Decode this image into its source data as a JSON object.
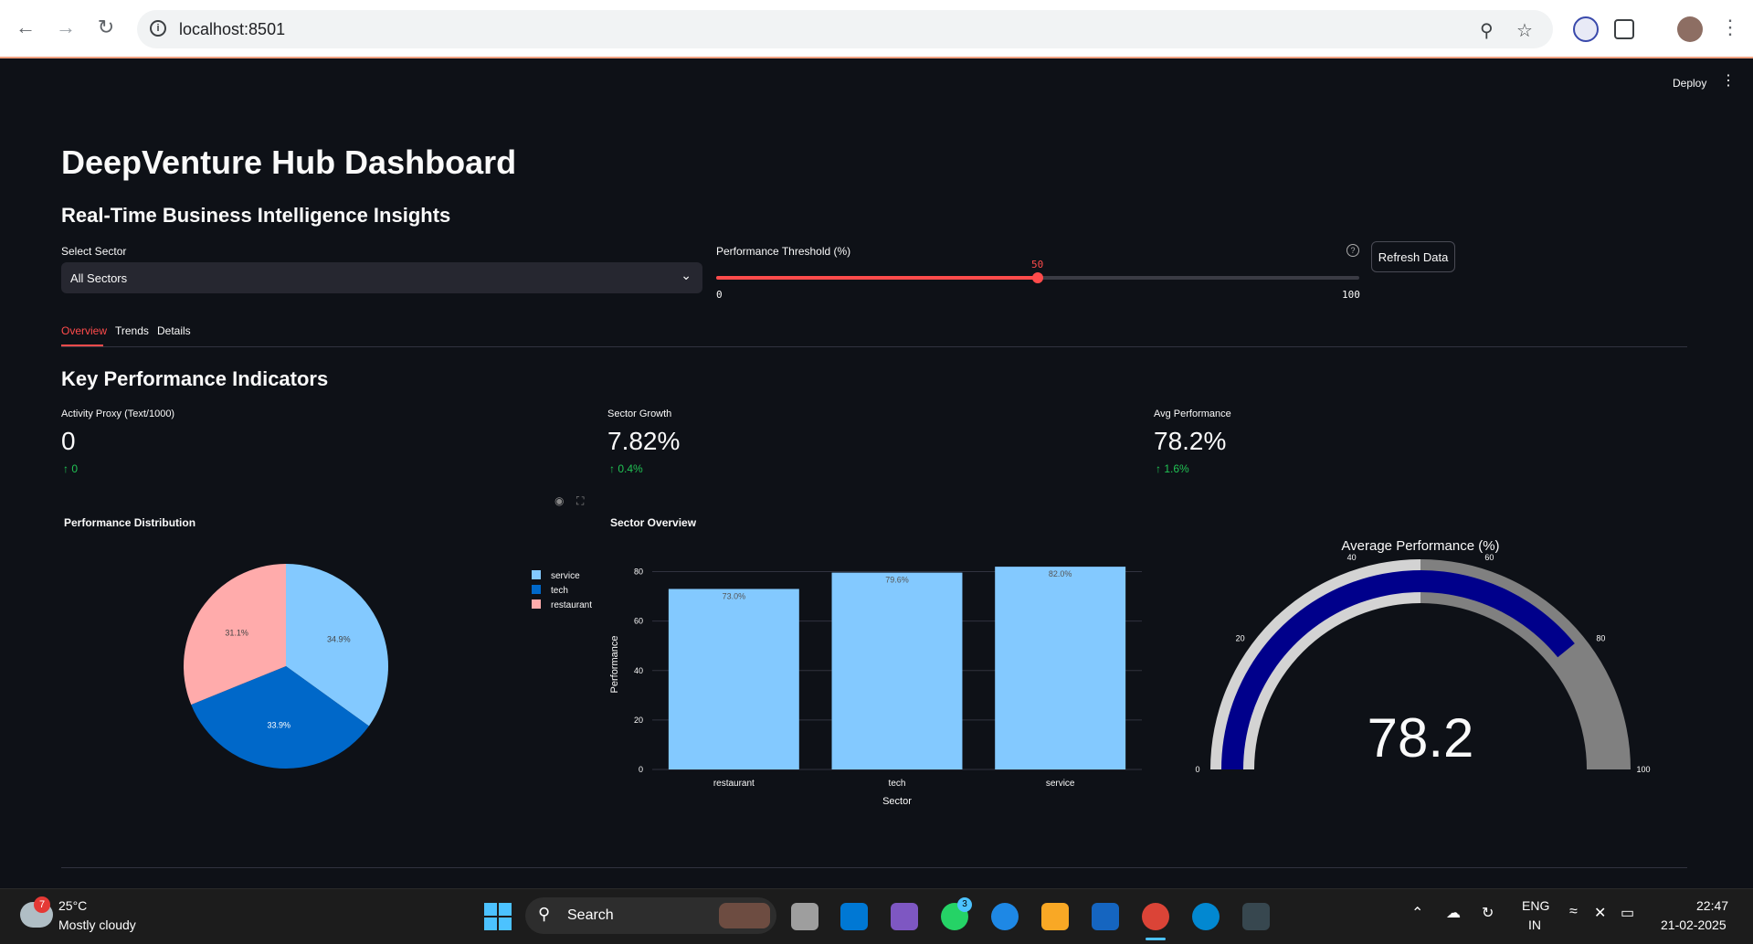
{
  "browser": {
    "url": "localhost:8501"
  },
  "app": {
    "deploy_label": "Deploy",
    "title": "DeepVenture Hub Dashboard",
    "subtitle": "Real-Time Business Intelligence Insights",
    "sector_select": {
      "label": "Select Sector",
      "value": "All Sectors"
    },
    "threshold": {
      "label": "Performance Threshold (%)",
      "value": 50,
      "value_label": "50",
      "min_label": "0",
      "max_label": "100"
    },
    "refresh_label": "Refresh Data",
    "tabs": [
      {
        "label": "Overview",
        "active": true
      },
      {
        "label": "Trends",
        "active": false
      },
      {
        "label": "Details",
        "active": false
      }
    ],
    "kpi_heading": "Key Performance Indicators",
    "metrics": [
      {
        "label": "Activity Proxy (Text/1000)",
        "value": "0",
        "delta": "0"
      },
      {
        "label": "Sector Growth",
        "value": "7.82%",
        "delta": "0.4%"
      },
      {
        "label": "Avg Performance",
        "value": "78.2%",
        "delta": "1.6%"
      }
    ]
  },
  "chart_data": [
    {
      "type": "pie",
      "title": "Performance Distribution",
      "labels": [
        "service",
        "tech",
        "restaurant"
      ],
      "values": [
        34.9,
        33.9,
        31.1
      ],
      "value_labels": [
        "34.9%",
        "33.9%",
        "31.1%"
      ],
      "colors": [
        "#83c9ff",
        "#0068c9",
        "#ffabab"
      ],
      "legend": "right"
    },
    {
      "type": "bar",
      "title": "Sector Overview",
      "categories": [
        "restaurant",
        "tech",
        "service"
      ],
      "values": [
        73.0,
        79.6,
        82.0
      ],
      "value_labels": [
        "73.0%",
        "79.6%",
        "82.0%"
      ],
      "xlabel": "Sector",
      "ylabel": "Performance",
      "ylim": [
        0,
        85
      ],
      "yticks": [
        0,
        20,
        40,
        60,
        80
      ],
      "color": "#83c9ff",
      "grid": true
    },
    {
      "type": "gauge",
      "title": "Average Performance (%)",
      "value": 78.2,
      "value_label": "78.2",
      "range": [
        0,
        100
      ],
      "ticks": [
        0,
        20,
        40,
        60,
        80,
        100
      ],
      "bar_color": "#00008b",
      "steps": [
        {
          "range": [
            0,
            50
          ],
          "color": "#d3d3d3"
        },
        {
          "range": [
            50,
            100
          ],
          "color": "#808080"
        }
      ]
    }
  ],
  "taskbar": {
    "weather_temp": "25°C",
    "weather_desc": "Mostly cloudy",
    "weather_badge": "7",
    "search_label": "Search",
    "whatsapp_badge": "3",
    "lang_1": "ENG",
    "lang_2": "IN",
    "time": "22:47",
    "date": "21-02-2025"
  }
}
